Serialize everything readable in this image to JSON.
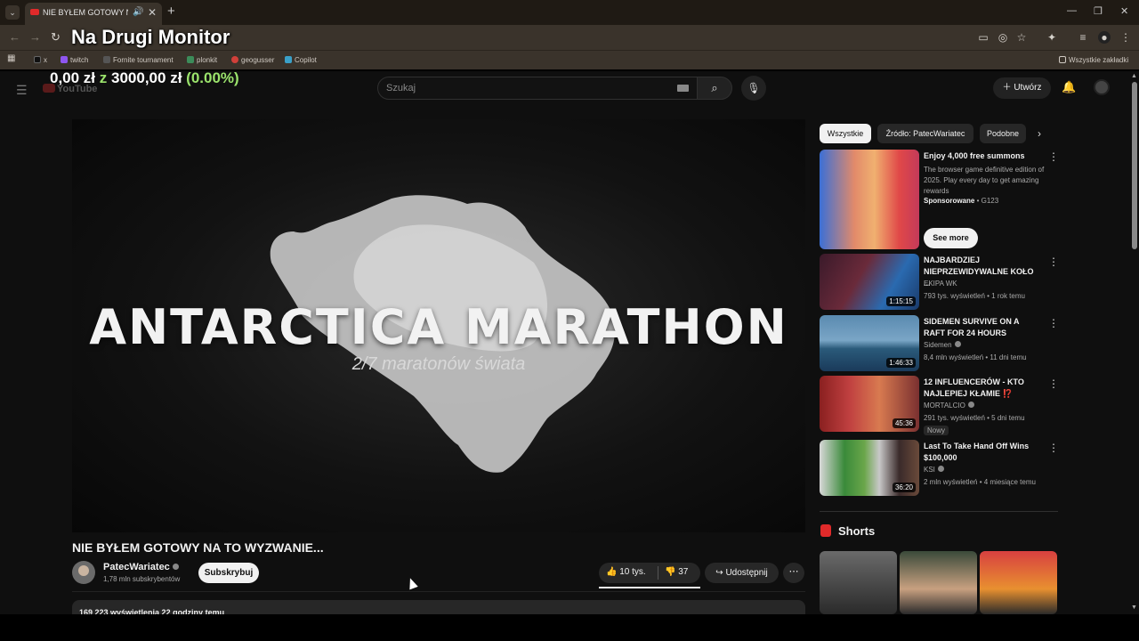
{
  "browser": {
    "tab_title": "NIE BYŁEM GOTOWY NA TO WYZWANIE...",
    "overlay_title": "Na Drugi Monitor",
    "bookmarks": [
      "x",
      "twitch",
      "Fornite tournament",
      "plonkit",
      "geogusser",
      "Copilot"
    ],
    "all_bookmarks": "Wszystkie zakładki"
  },
  "overlay": {
    "amount": "0,00 zł",
    "z": "z",
    "goal": "3000,00 zł",
    "percent": "(0.00%)"
  },
  "youtube": {
    "logo": "YouTube",
    "search_placeholder": "Szukaj",
    "create_label": "Utwórz"
  },
  "video": {
    "overlay_title": "ANTARCTICA MARATHON",
    "overlay_subtitle": "2/7 maratonów świata",
    "title": "NIE BYŁEM GOTOWY NA TO WYZWANIE...",
    "channel": "PatecWariatec",
    "subscribers": "1,78 mln subskrybentów",
    "subscribe_label": "Subskrybuj",
    "likes": "10 tys.",
    "dislikes": "37",
    "share_label": "Udostępnij",
    "views_info": "169 223 wyświetlenia  22 godziny temu"
  },
  "chips": [
    "Wszystkie",
    "Źródło: PatecWariatec",
    "Podobne"
  ],
  "ad": {
    "title": "Enjoy 4,000 free summons",
    "description": "The browser game definitive edition of 2025. Play every day to get amazing rewards",
    "sponsored": "Sponsorowane",
    "advertiser": "G123",
    "see_more": "See more"
  },
  "related": [
    {
      "title": "NAJBARDZIEJ NIEPRZEWIDYWALNE KOŁO ...",
      "channel": "EKIPA WK",
      "meta": "793 tys. wyświetleń • 1 rok temu",
      "duration": "1:15:15",
      "badge": ""
    },
    {
      "title": "SIDEMEN SURVIVE ON A RAFT FOR 24 HOURS",
      "channel": "Sidemen",
      "meta": "8,4 mln wyświetleń • 11 dni temu",
      "duration": "1:46:33",
      "badge": ""
    },
    {
      "title": "12 INFLUENCERÓW - KTO NAJLEPIEJ KŁAMIE ⁉️",
      "channel": "MORTALCIO",
      "meta": "291 tys. wyświetleń • 5 dni temu",
      "duration": "45:36",
      "badge": "Nowy"
    },
    {
      "title": "Last To Take Hand Off Wins $100,000",
      "channel": "KSI",
      "meta": "2 mln wyświetleń • 4 miesiące temu",
      "duration": "36:20",
      "badge": ""
    }
  ],
  "shorts": {
    "title": "Shorts"
  }
}
